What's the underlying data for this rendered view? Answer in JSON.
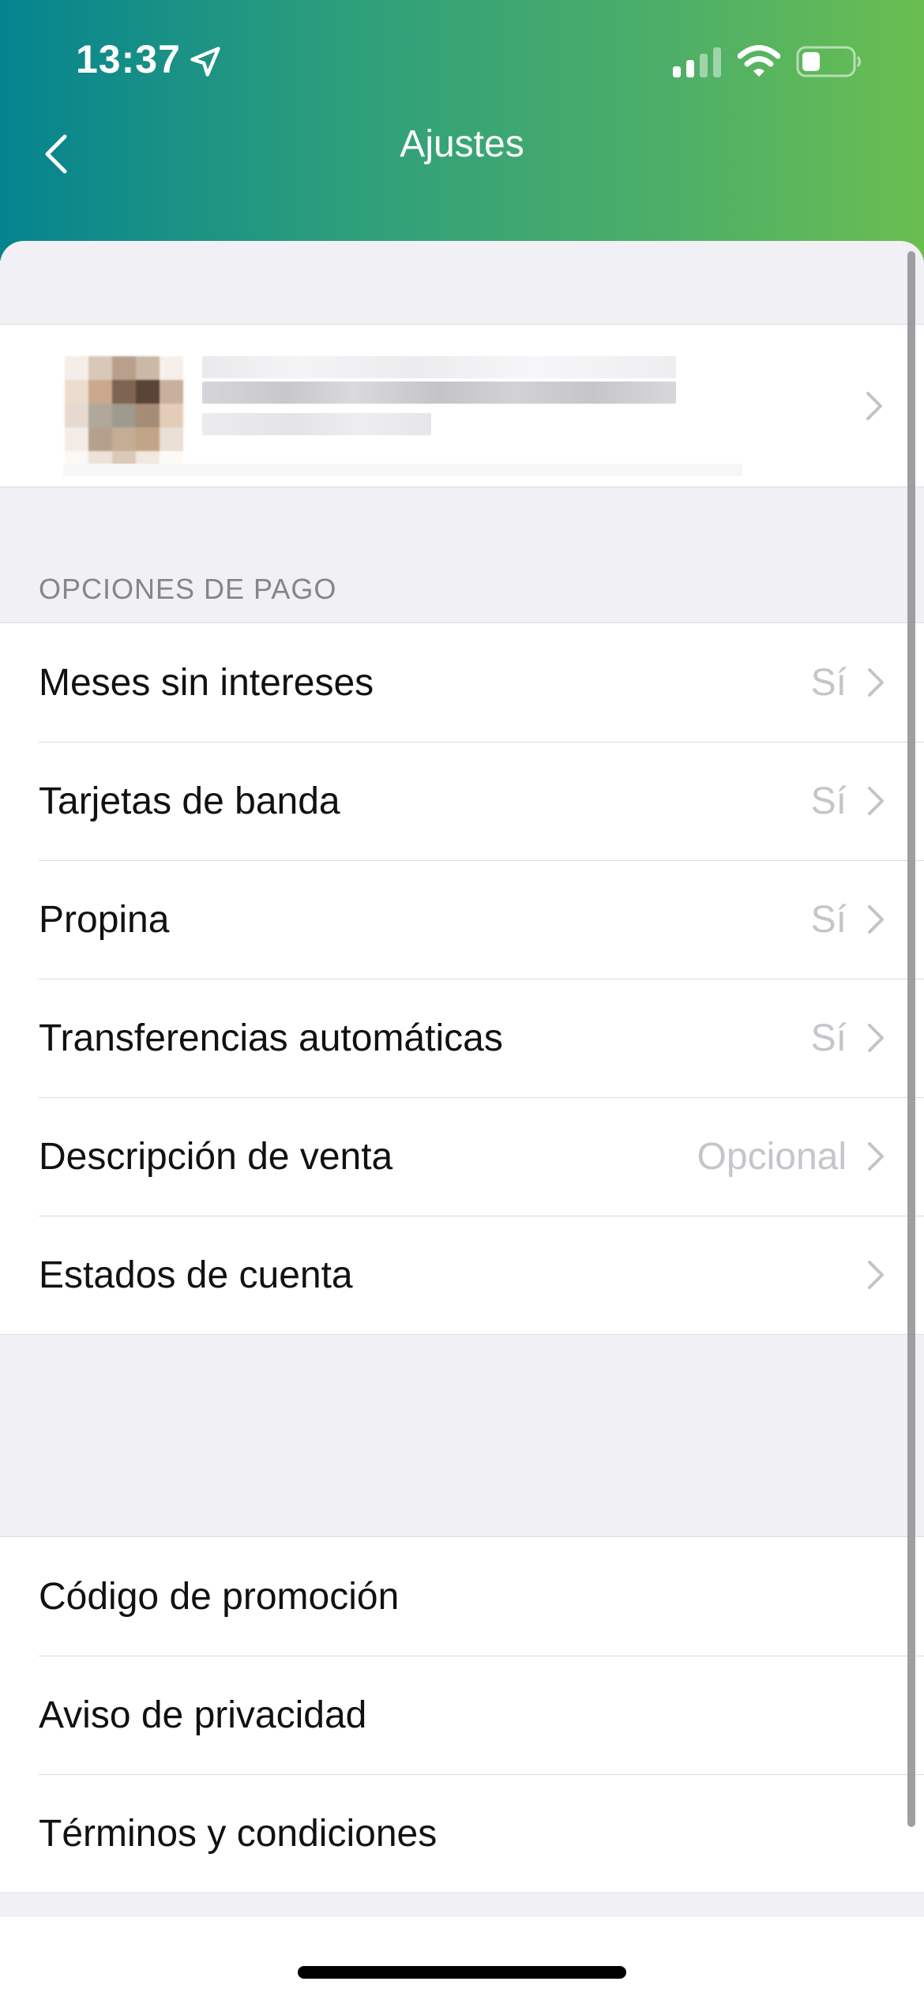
{
  "status_bar": {
    "time": "13:37"
  },
  "nav": {
    "title": "Ajustes"
  },
  "sections": {
    "payment_header": "OPCIONES DE PAGO",
    "payment_items": [
      {
        "label": "Meses sin intereses",
        "value": "Sí"
      },
      {
        "label": "Tarjetas de banda",
        "value": "Sí"
      },
      {
        "label": "Propina",
        "value": "Sí"
      },
      {
        "label": "Transferencias automáticas",
        "value": "Sí"
      },
      {
        "label": "Descripción de venta",
        "value": "Opcional"
      },
      {
        "label": "Estados de cuenta",
        "value": ""
      }
    ],
    "info_items": [
      {
        "label": "Código de promoción"
      },
      {
        "label": "Aviso de privacidad"
      },
      {
        "label": "Términos y condiciones"
      }
    ]
  },
  "colors": {
    "header_gradient_start": "#05848f",
    "header_gradient_end": "#6abe50",
    "background": "#f0f0f5",
    "value_text": "#c5c5ca",
    "section_header_text": "#85858a"
  },
  "icons": [
    "location-arrow-icon",
    "cellular-signal-icon",
    "wifi-icon",
    "battery-icon",
    "back-chevron-icon",
    "chevron-right-icon"
  ]
}
